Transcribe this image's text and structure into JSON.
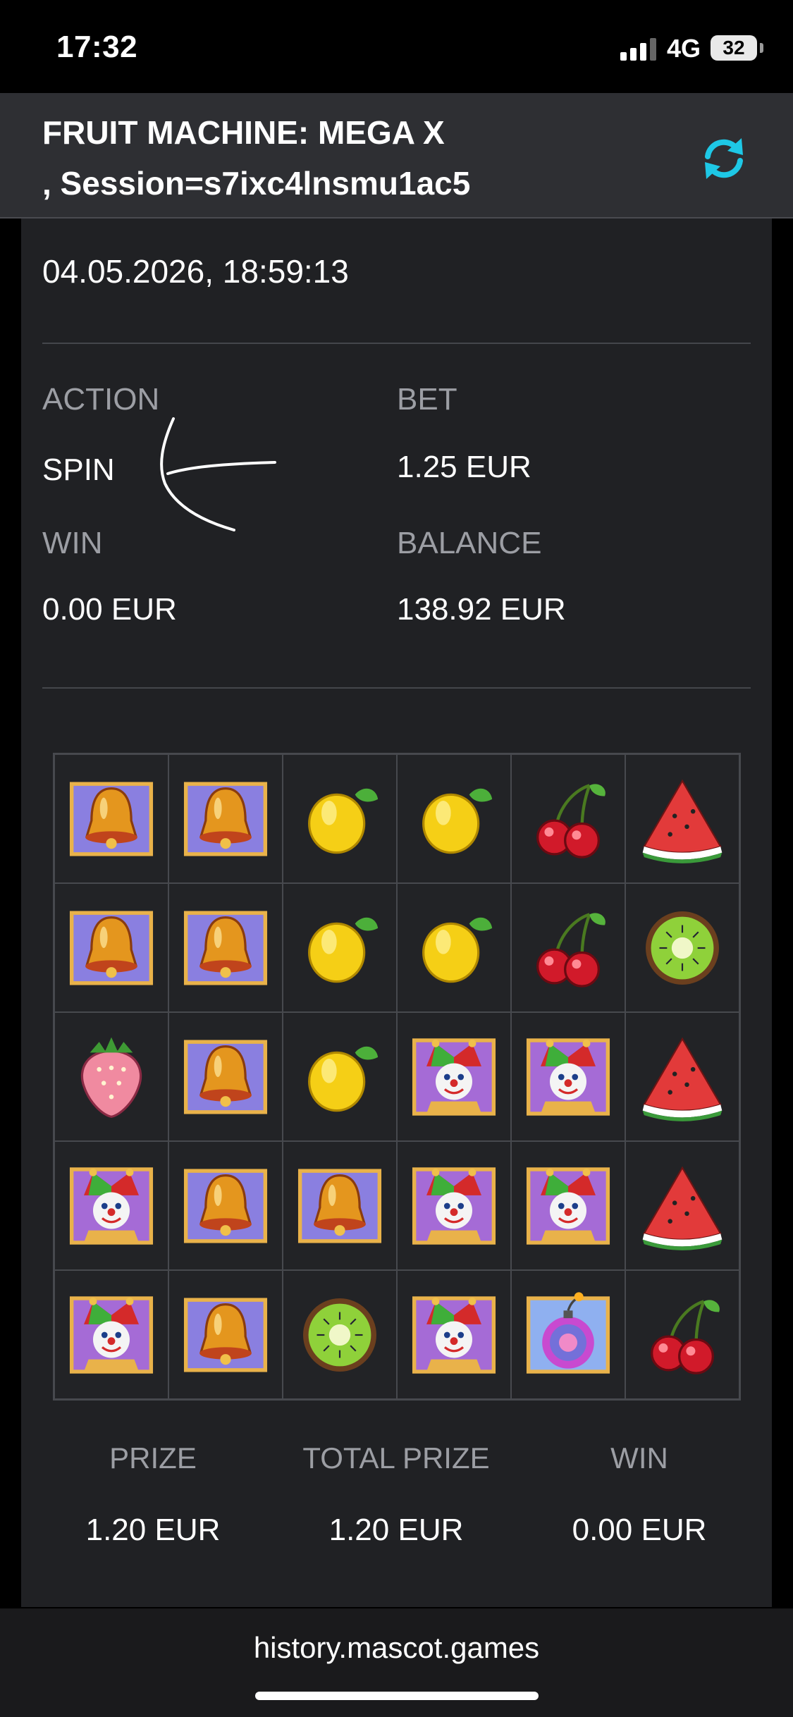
{
  "status_bar": {
    "time": "17:32",
    "network": "4G",
    "battery": "32"
  },
  "header": {
    "title_line1": "FRUIT MACHINE: MEGA X",
    "title_line2": ", Session=s7ixc4lnsmu1ac5",
    "refresh_icon": "refresh-icon"
  },
  "round": {
    "datetime": "04.05.2026, 18:59:13",
    "action_label": "ACTION",
    "action_value": "SPIN",
    "bet_label": "BET",
    "bet_value": "1.25 EUR",
    "win_label": "WIN",
    "win_value": "0.00 EUR",
    "balance_label": "BALANCE",
    "balance_value": "138.92 EUR"
  },
  "reels": [
    [
      "bell",
      "bell",
      "lemon",
      "lemon",
      "cherry",
      "watermelon"
    ],
    [
      "bell",
      "bell",
      "lemon",
      "lemon",
      "cherry",
      "kiwi"
    ],
    [
      "strawberry",
      "bell",
      "lemon",
      "joker",
      "joker",
      "watermelon"
    ],
    [
      "joker",
      "bell",
      "bell",
      "joker",
      "joker",
      "watermelon"
    ],
    [
      "joker",
      "bell",
      "kiwi",
      "joker",
      "bomb",
      "cherry"
    ]
  ],
  "summary": {
    "prize_label": "PRIZE",
    "prize_value": "1.20 EUR",
    "total_prize_label": "TOTAL PRIZE",
    "total_prize_value": "1.20 EUR",
    "win_label": "WIN",
    "win_value": "0.00 EUR"
  },
  "browser": {
    "url": "history.mascot.games"
  },
  "colors": {
    "accent": "#1ec8e6",
    "panel": "#202124",
    "header": "#2e2f33"
  }
}
